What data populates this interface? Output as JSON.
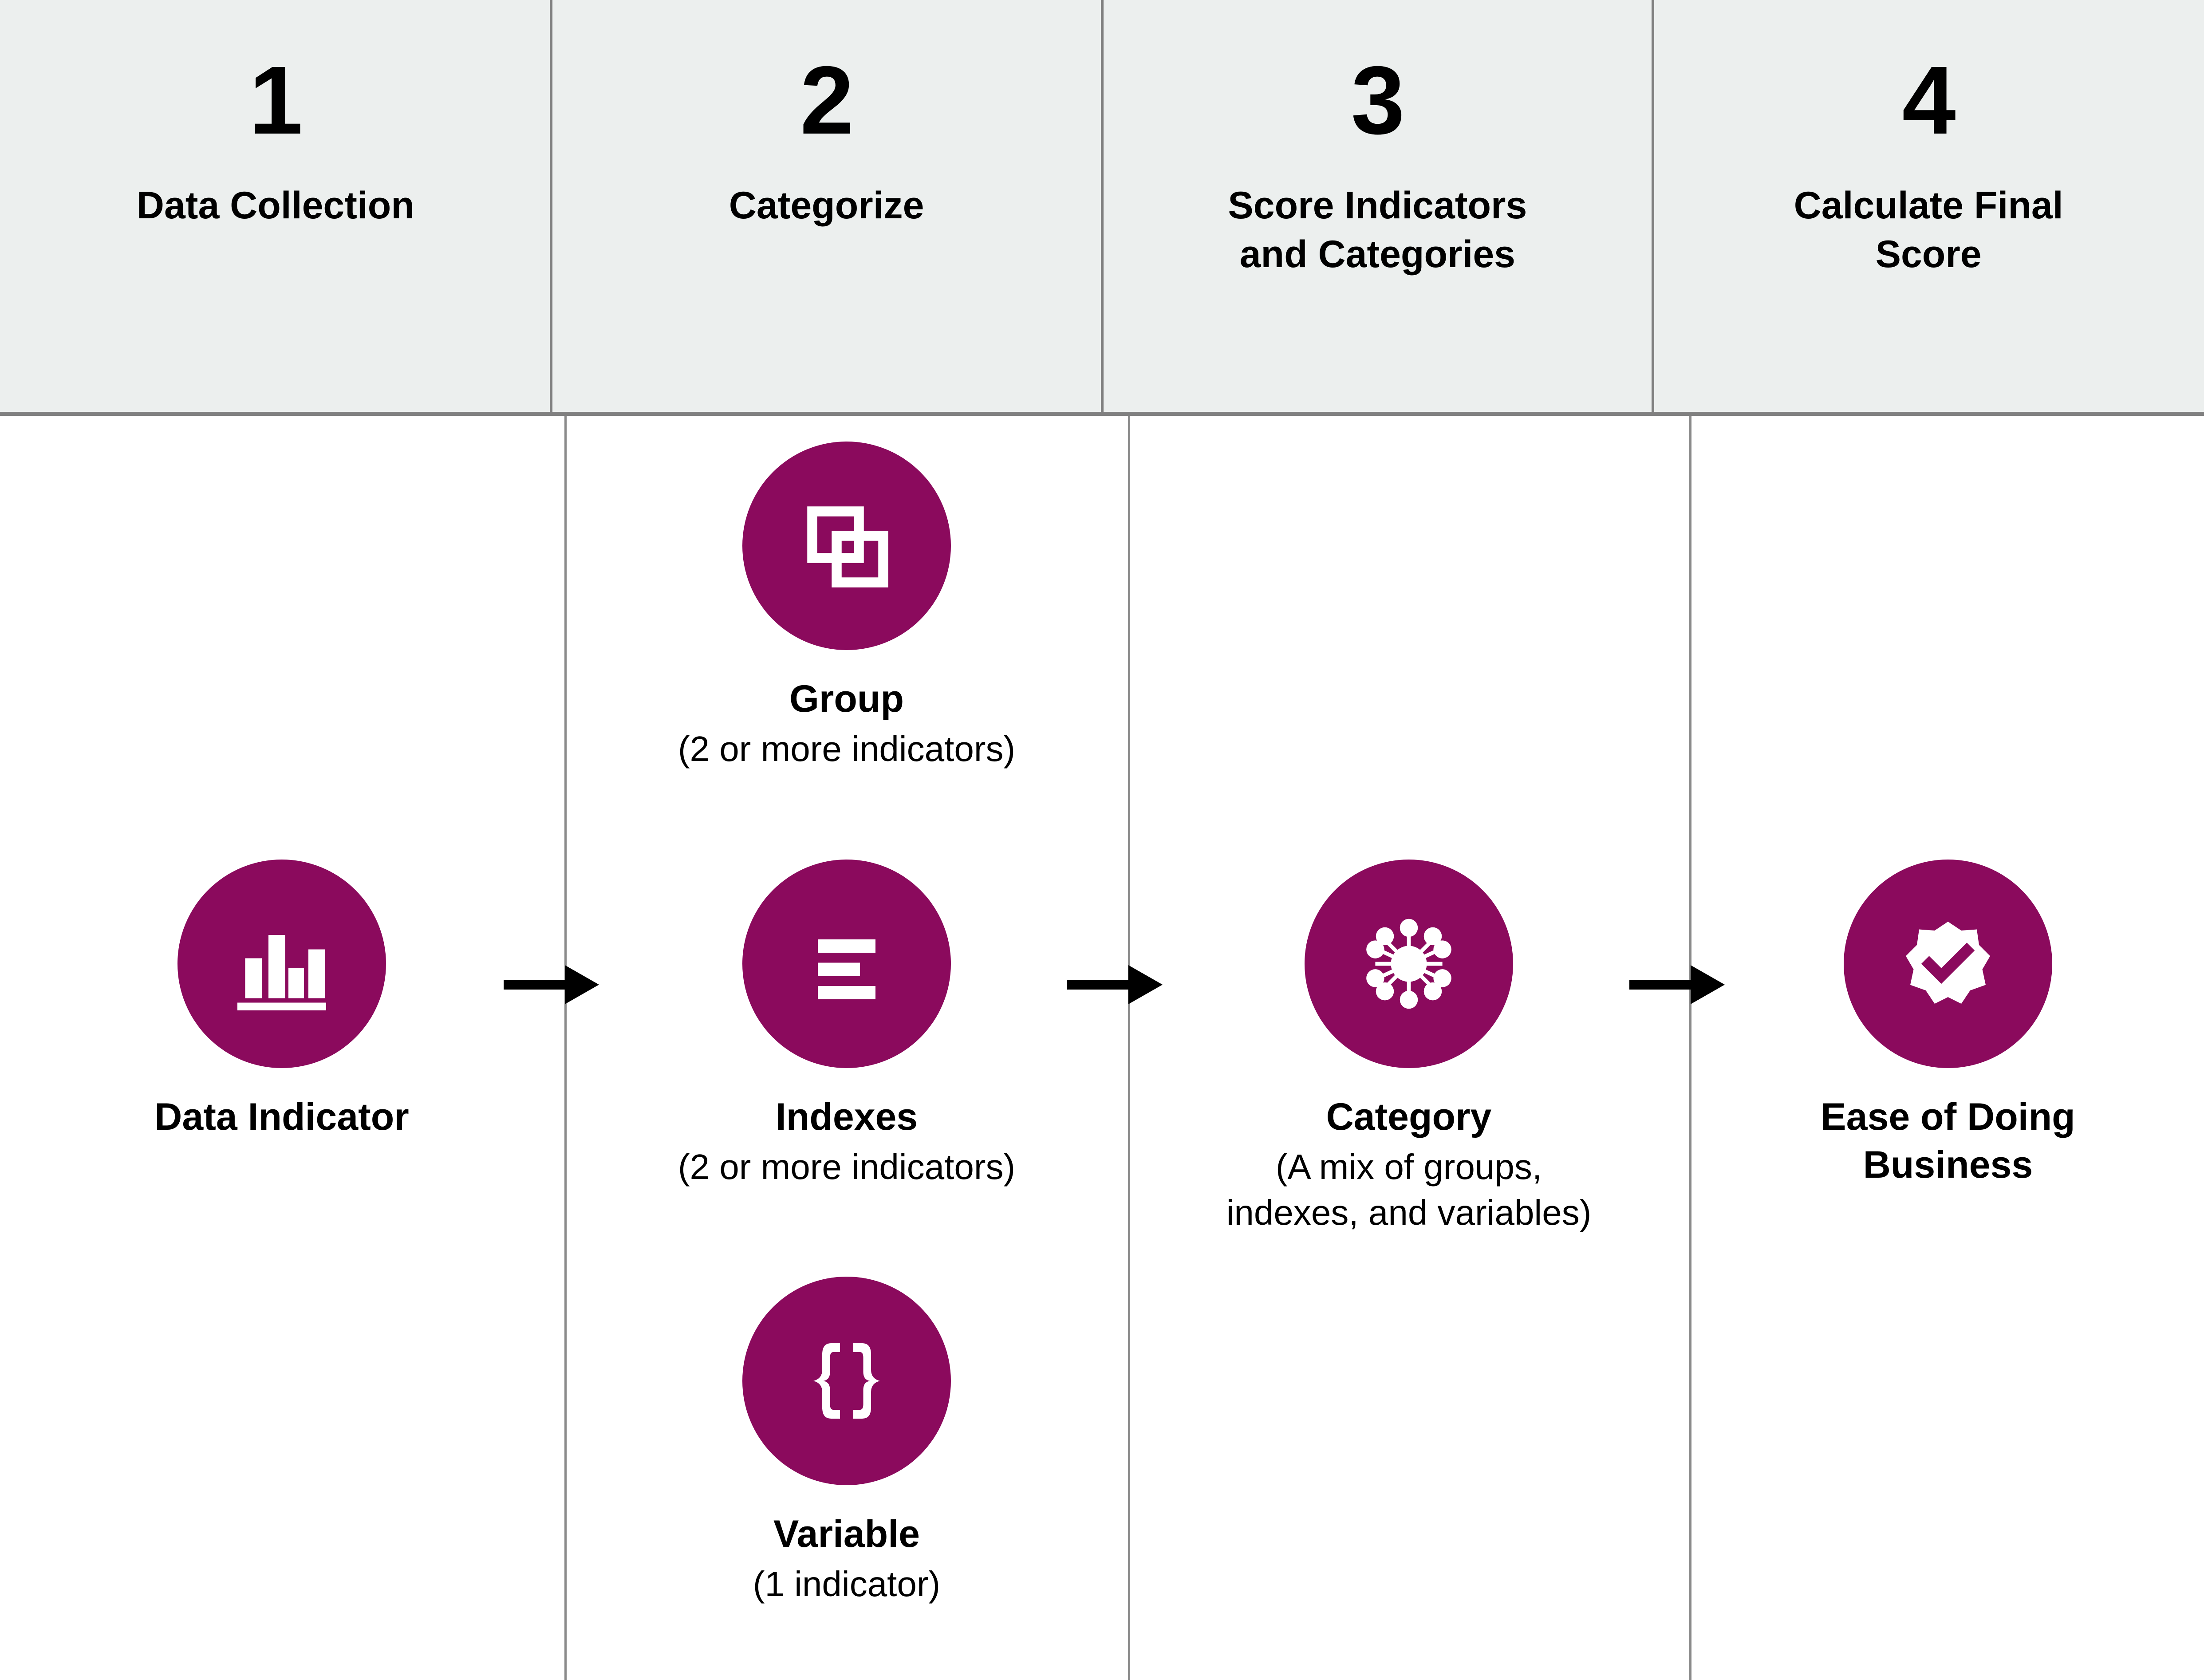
{
  "header": {
    "steps": [
      {
        "number": "1",
        "title": "Data Collection"
      },
      {
        "number": "2",
        "title": "Categorize"
      },
      {
        "number": "3",
        "title": "Score Indicators\nand Categories"
      },
      {
        "number": "4",
        "title": "Calculate Final\nScore"
      }
    ]
  },
  "nodes": {
    "data_indicator": {
      "label": "Data Indicator",
      "sub": "",
      "icon": "bar-chart-icon"
    },
    "group": {
      "label": "Group",
      "sub": "(2 or more indicators)",
      "icon": "overlapping-squares-icon"
    },
    "indexes": {
      "label": "Indexes",
      "sub": "(2 or more indicators)",
      "icon": "stacked-lines-icon"
    },
    "variable": {
      "label": "Variable",
      "sub": "(1 indicator)",
      "icon": "curly-braces-icon"
    },
    "category": {
      "label": "Category",
      "sub": "(A mix of groups,\nindexes, and variables)",
      "icon": "network-hub-icon"
    },
    "ease_of_doing_business": {
      "label": "Ease of Doing\nBusiness",
      "sub": "",
      "icon": "badge-check-icon"
    }
  },
  "flow": {
    "arrows": [
      {
        "name": "arrow-indicator-to-indexes"
      },
      {
        "name": "arrow-indexes-to-category"
      },
      {
        "name": "arrow-category-to-ease"
      }
    ]
  },
  "colors": {
    "accent_purple": "#8b0a5d",
    "header_background": "#ecefee",
    "divider_gray": "#808080",
    "icon_fill": "#ffffff",
    "text": "#000000",
    "page_background": "#ffffff"
  }
}
